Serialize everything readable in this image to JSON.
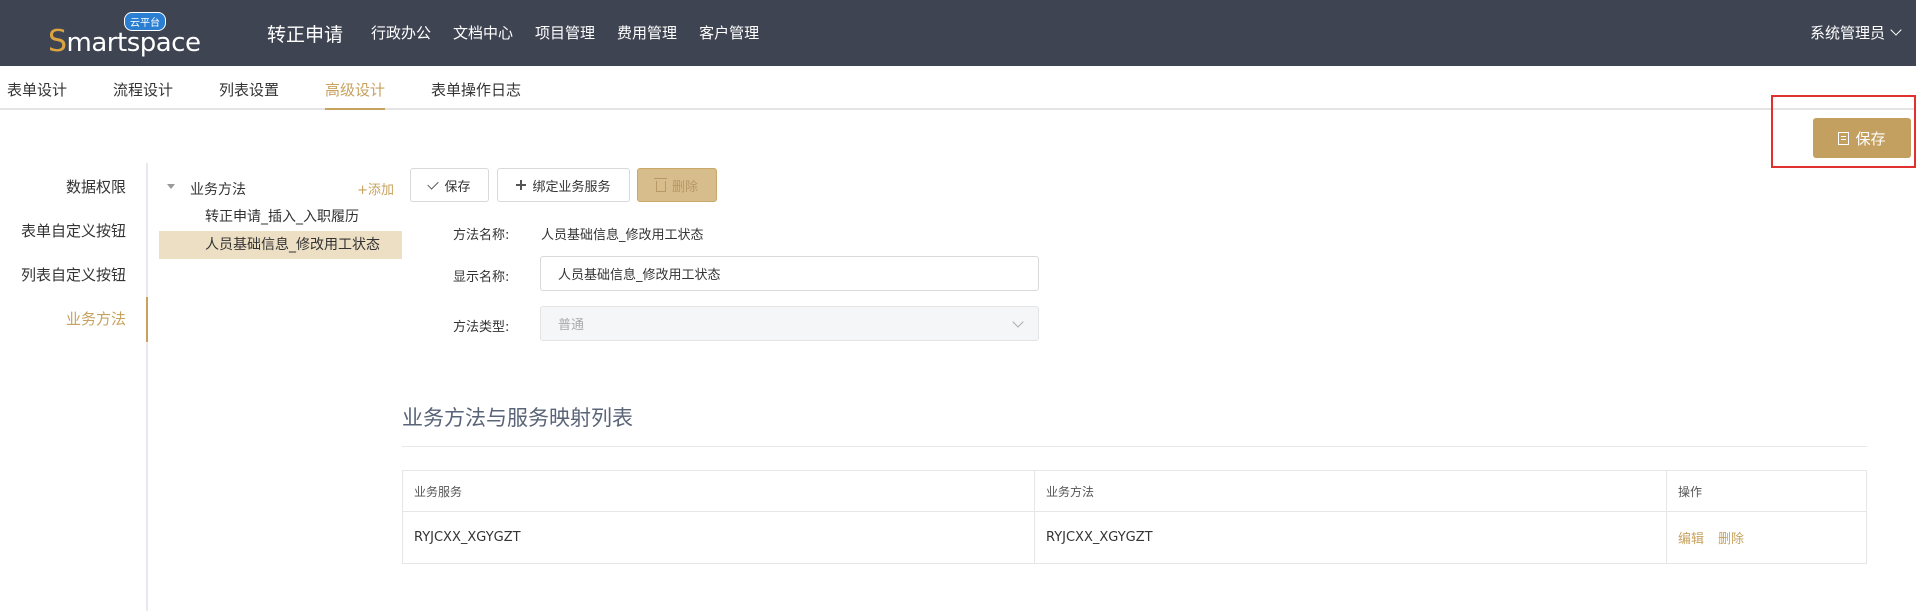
{
  "header": {
    "logo_text_rest": "martspace",
    "logo_text_s": "S",
    "logo_badge": "云平台",
    "title": "转正申请",
    "nav": [
      "行政办公",
      "文档中心",
      "项目管理",
      "费用管理",
      "客户管理"
    ],
    "user": "系统管理员"
  },
  "subtabs": [
    "表单设计",
    "流程设计",
    "列表设置",
    "高级设计",
    "表单操作日志"
  ],
  "top_save_label": "保存",
  "leftnav": [
    "数据权限",
    "表单自定义按钮",
    "列表自定义按钮",
    "业务方法"
  ],
  "tree": {
    "root_label": "业务方法",
    "add_label": "+添加",
    "items": [
      "转正申请_插入_入职履历",
      "人员基础信息_修改用工状态"
    ]
  },
  "toolbar": {
    "save_label": "保存",
    "bind_label": "绑定业务服务",
    "delete_label": "删除"
  },
  "form": {
    "method_name_label": "方法名称:",
    "method_name_value": "人员基础信息_修改用工状态",
    "display_name_label": "显示名称:",
    "display_name_value": "人员基础信息_修改用工状态",
    "method_type_label": "方法类型:",
    "method_type_value": "普通"
  },
  "mapping": {
    "title": "业务方法与服务映射列表",
    "columns": [
      "业务服务",
      "业务方法",
      "操作"
    ],
    "rows": [
      {
        "service": "RYJCXX_XGYGZT",
        "method": "RYJCXX_XGYGZT",
        "edit": "编辑",
        "delete": "删除"
      }
    ]
  },
  "colors": {
    "header_bg": "#3f4452",
    "accent": "#c7a25e",
    "highlight": "#e03030"
  }
}
